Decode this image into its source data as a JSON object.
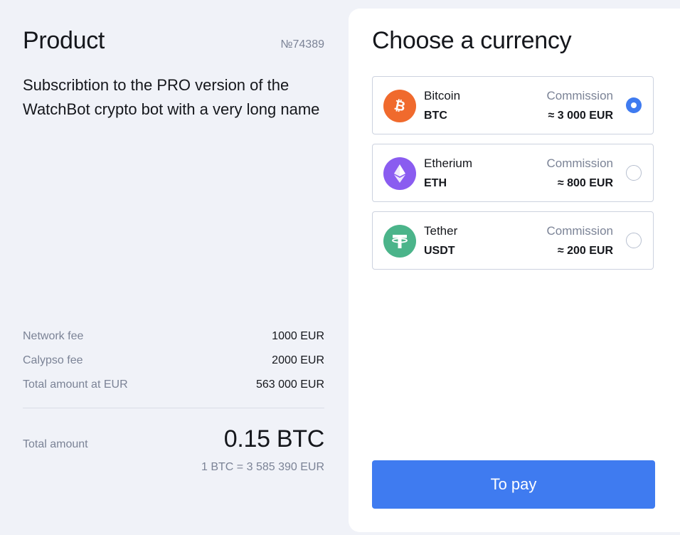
{
  "product": {
    "title": "Product",
    "order_number": "№74389",
    "description": "Subscribtion to the PRO version of the WatchBot crypto bot with a very long name"
  },
  "fees": [
    {
      "label": "Network fee",
      "value": "1000 EUR"
    },
    {
      "label": "Calypso fee",
      "value": "2000 EUR"
    },
    {
      "label": "Total amount at EUR",
      "value": "563 000 EUR"
    }
  ],
  "total": {
    "label": "Total amount",
    "value": "0.15 BTC",
    "rate": "1 BTC = 3 585 390 EUR"
  },
  "currency_panel": {
    "title": "Choose a currency",
    "options": [
      {
        "name": "Bitcoin",
        "ticker": "BTC",
        "commission_label": "Commission",
        "commission_value": "≈ 3 000 EUR",
        "icon": "bitcoin-icon",
        "selected": true
      },
      {
        "name": "Etherium",
        "ticker": "ETH",
        "commission_label": "Commission",
        "commission_value": "≈ 800 EUR",
        "icon": "ethereum-icon",
        "selected": false
      },
      {
        "name": "Tether",
        "ticker": "USDT",
        "commission_label": "Commission",
        "commission_value": "≈ 200 EUR",
        "icon": "tether-icon",
        "selected": false
      }
    ],
    "pay_button": "To pay"
  },
  "colors": {
    "accent": "#3f7bf0",
    "background": "#f0f2f8",
    "muted_text": "#7b8396",
    "bitcoin": "#f06a2d",
    "ethereum": "#8a5cf0",
    "tether": "#4bb48a"
  }
}
